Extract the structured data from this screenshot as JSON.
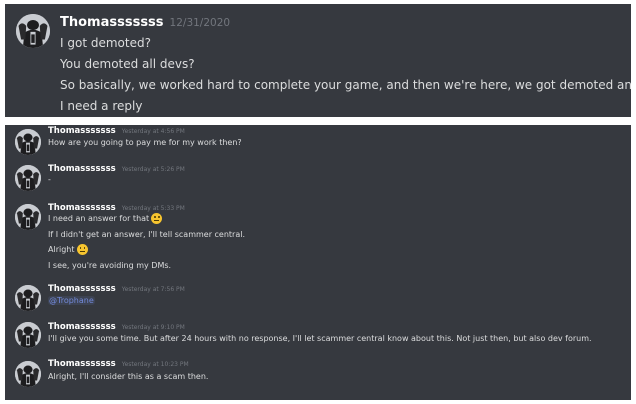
{
  "top_panel": {
    "author": "Thomasssssss",
    "timestamp": "12/31/2020",
    "lines": [
      "I got demoted?",
      "You demoted all devs?",
      "So basically, we worked hard to complete your game, and then we're here, we got demoted and got nothing?",
      "I need a reply"
    ]
  },
  "bottom_panel": {
    "messages": [
      {
        "author": "Thomasssssss",
        "timestamp": "Yesterday at 4:56 PM",
        "lines": [
          "How are you going to pay me for my work then?"
        ]
      },
      {
        "author": "Thomasssssss",
        "timestamp": "Yesterday at 5:26 PM",
        "lines": [
          "-"
        ]
      },
      {
        "author": "Thomasssssss",
        "timestamp": "Yesterday at 5:33 PM",
        "lines": [
          "I need an answer for that",
          "If I didn't get an answer, I'll tell scammer central.",
          "Alright",
          "I see, you're avoiding my DMs."
        ],
        "emoji": "slightly-frowning-face"
      },
      {
        "author": "Thomasssssss",
        "timestamp": "Yesterday at 7:56 PM",
        "mention": "@Trophane"
      },
      {
        "author": "Thomasssssss",
        "timestamp": "Yesterday at 9:10 PM",
        "lines": [
          "I'll give you some time. But after 24 hours with no response, I'll let scammer central know about this. Not just then, but also dev forum."
        ]
      },
      {
        "author": "Thomasssssss",
        "timestamp": "Yesterday at 10:23 PM",
        "lines": [
          "Alright, I'll consider this as a scam then."
        ]
      }
    ]
  },
  "colors": {
    "background": "#36393f",
    "author": "#ffffff",
    "text": "#dcddde",
    "timestamp": "#72767d",
    "mention": "#7289da"
  }
}
